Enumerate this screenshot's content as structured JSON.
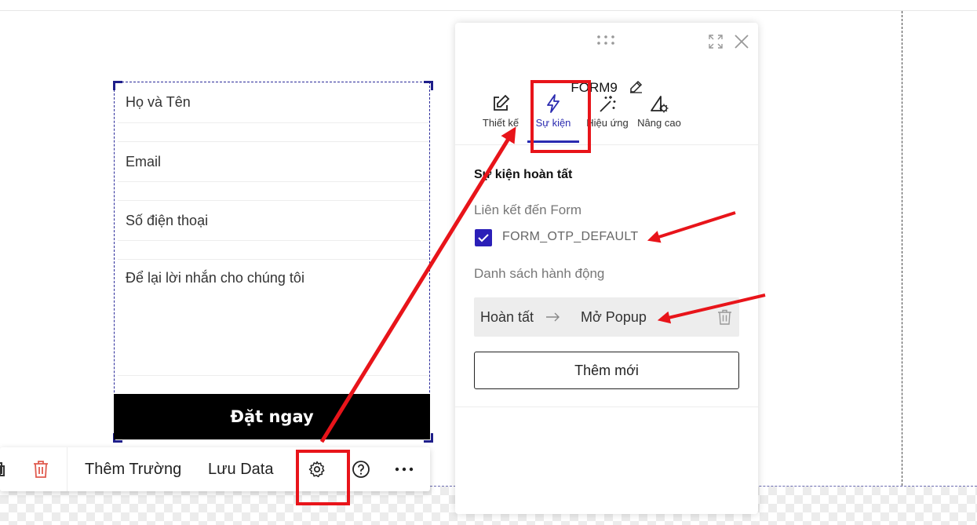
{
  "form": {
    "fields": [
      {
        "placeholder": "Họ và Tên"
      },
      {
        "placeholder": "Email"
      },
      {
        "placeholder": "Số điện thoại"
      },
      {
        "placeholder": "Để lại lời nhắn cho chúng tôi"
      }
    ],
    "submit_label": "Đặt ngay"
  },
  "toolbar": {
    "items": [
      {
        "label": "Thêm Trường"
      },
      {
        "label": "Lưu Data"
      }
    ],
    "icons": [
      "copy-icon",
      "trash-icon",
      "gear-icon",
      "help-icon",
      "more-icon"
    ]
  },
  "panel": {
    "title": "FORM9",
    "tabs": [
      {
        "label": "Thiết kế",
        "icon": "edit-icon"
      },
      {
        "label": "Sự kiện",
        "icon": "lightning-icon"
      },
      {
        "label": "Hiệu ứng",
        "icon": "magic-wand-icon"
      },
      {
        "label": "Nâng cao",
        "icon": "advanced-settings-icon"
      }
    ],
    "active_tab": "Sự kiện",
    "section_title": "Sự kiện hoàn tất",
    "link_label": "Liên kết đến Form",
    "linked_form": {
      "name": "FORM_OTP_DEFAULT",
      "checked": true
    },
    "actions_label": "Danh sách hành động",
    "actions": [
      {
        "trigger": "Hoàn tất",
        "action": "Mở Popup"
      }
    ],
    "add_button": "Thêm mới"
  },
  "colors": {
    "accent": "#2b1fb8",
    "annotation": "#e8141a",
    "submit_bg": "#000000"
  }
}
